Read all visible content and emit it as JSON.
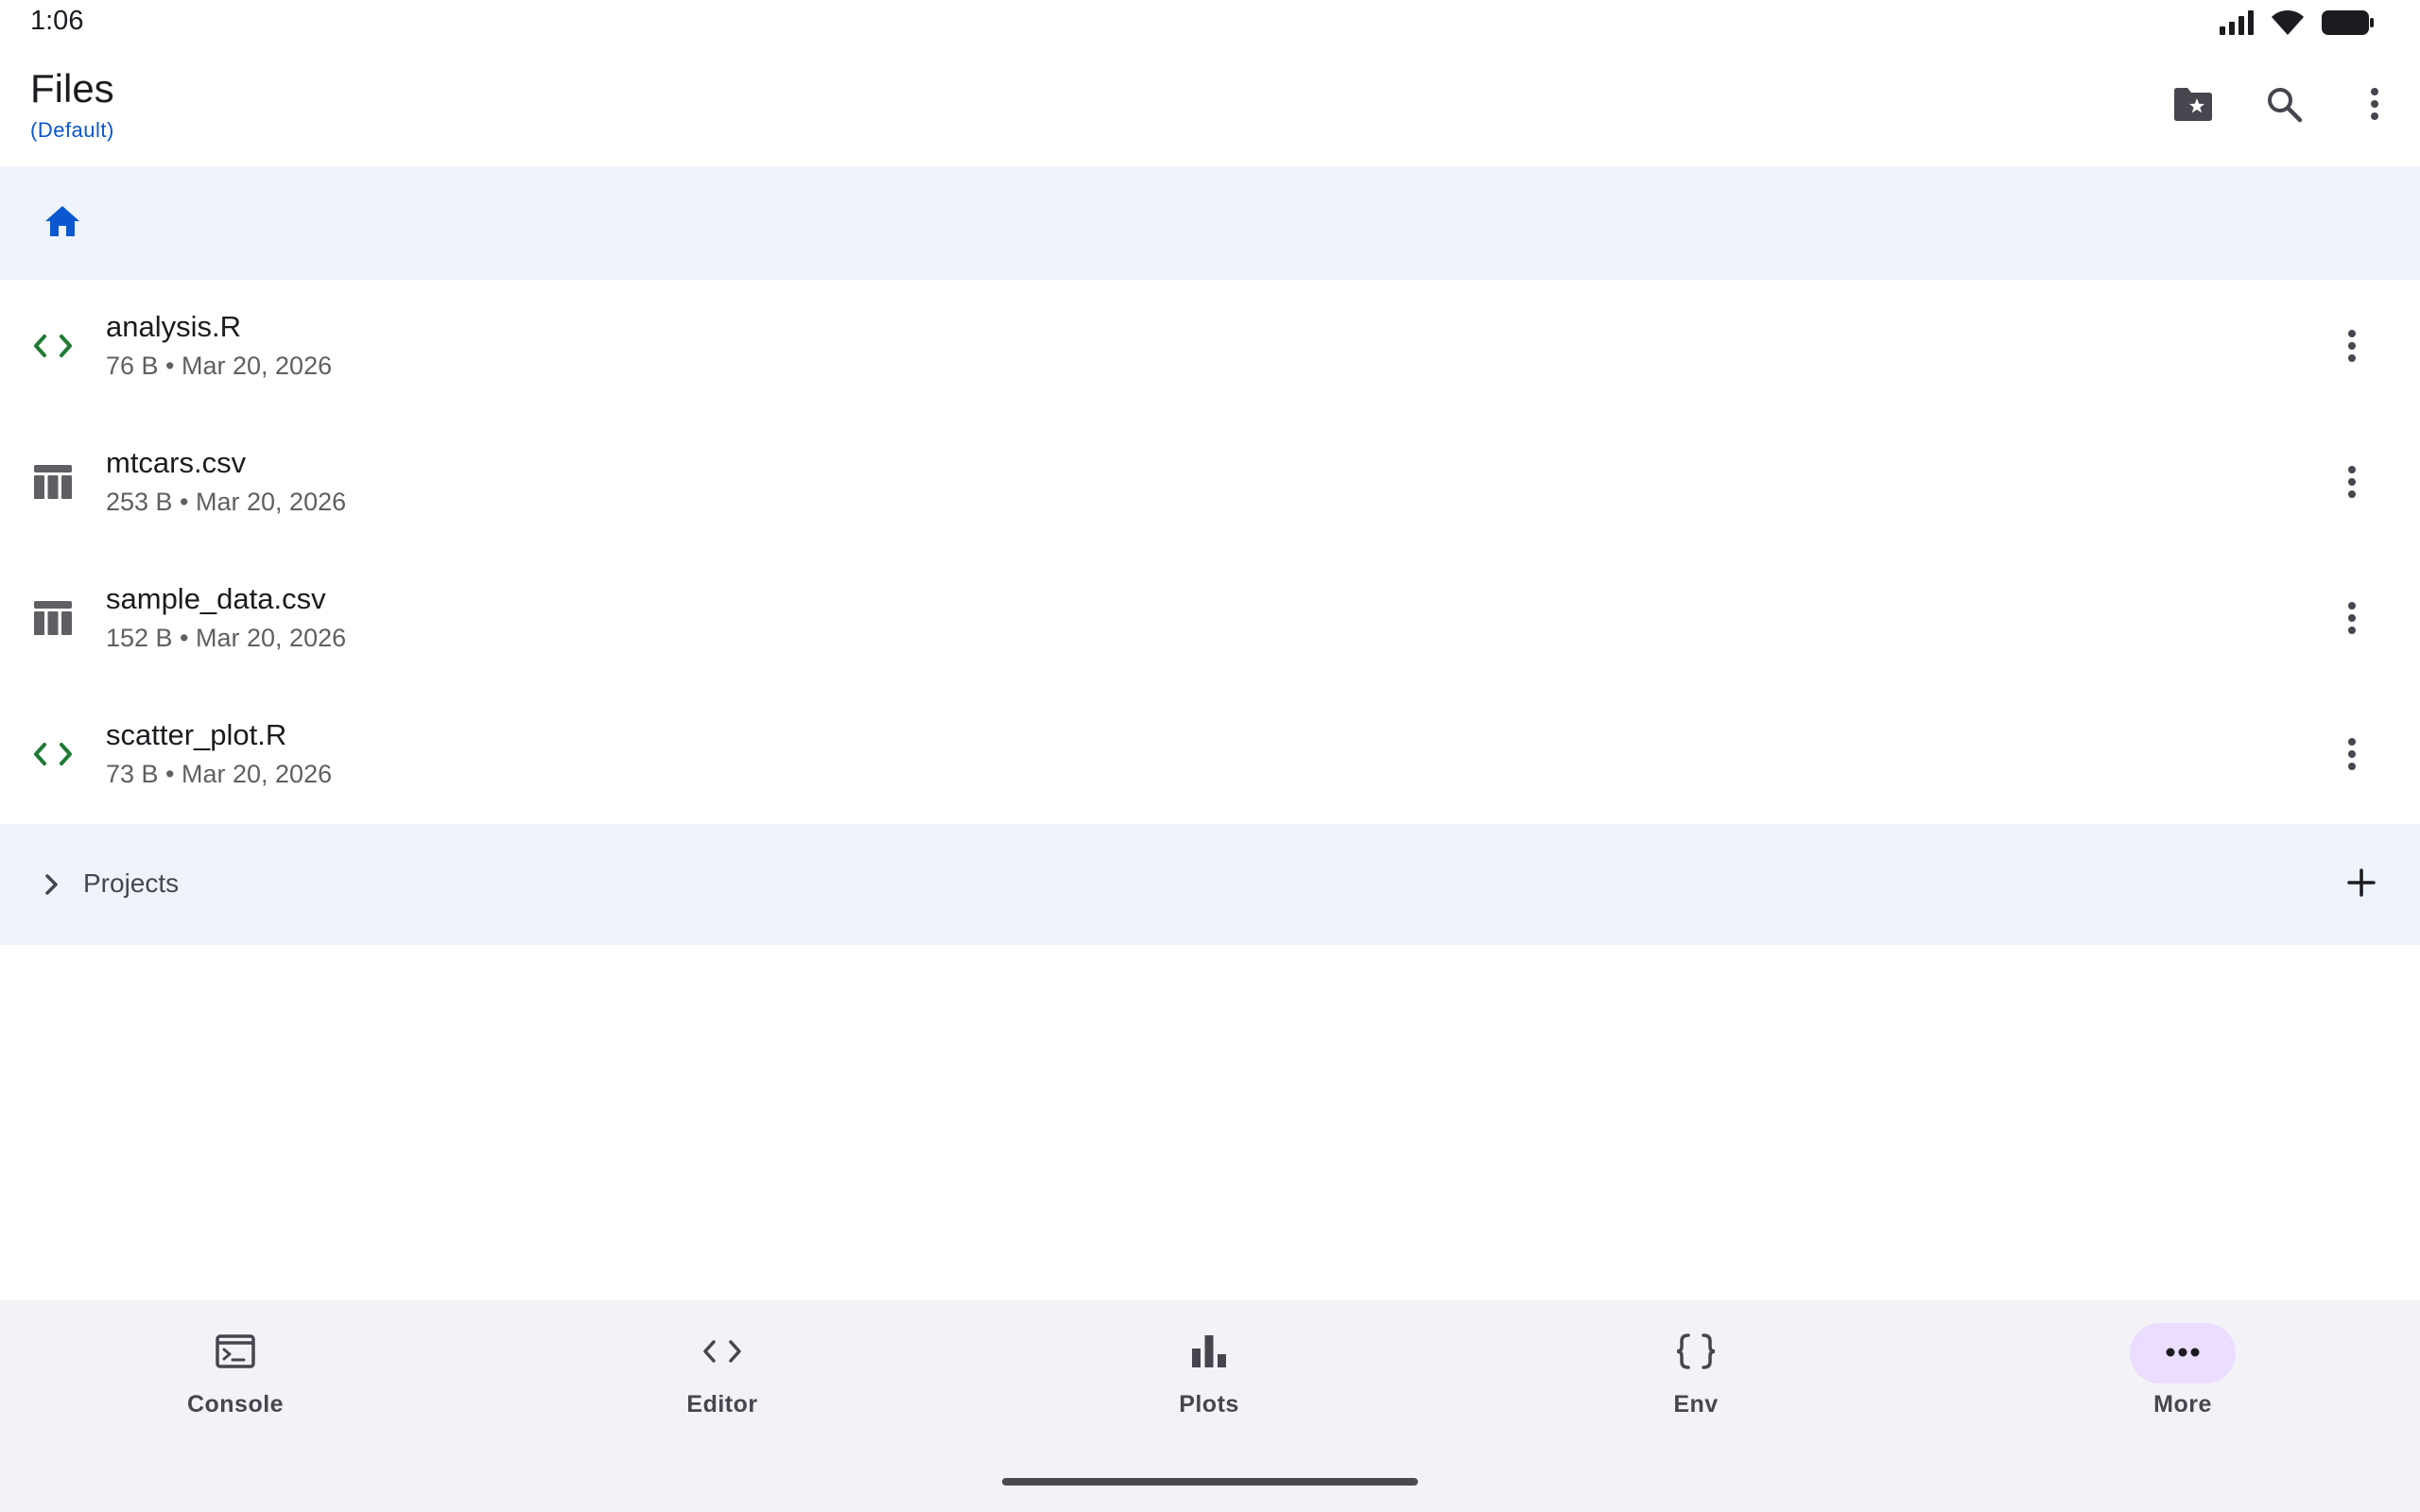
{
  "status_bar": {
    "time": "1:06"
  },
  "header": {
    "title": "Files",
    "subtitle": "(Default)"
  },
  "files": [
    {
      "name": "analysis.R",
      "meta": "76 B • Mar 20, 2026",
      "icon": "code-icon"
    },
    {
      "name": "mtcars.csv",
      "meta": "253 B • Mar 20, 2026",
      "icon": "table-icon"
    },
    {
      "name": "sample_data.csv",
      "meta": "152 B • Mar 20, 2026",
      "icon": "table-icon"
    },
    {
      "name": "scatter_plot.R",
      "meta": "73 B • Mar 20, 2026",
      "icon": "code-icon"
    }
  ],
  "projects": {
    "label": "Projects"
  },
  "bottom_nav": [
    {
      "label": "Console",
      "icon": "terminal-icon"
    },
    {
      "label": "Editor",
      "icon": "code-icon"
    },
    {
      "label": "Plots",
      "icon": "bar-chart-icon"
    },
    {
      "label": "Env",
      "icon": "braces-icon"
    },
    {
      "label": "More",
      "icon": "more-horiz-icon",
      "active": true
    }
  ],
  "colors": {
    "accent": "#0b57d0",
    "code_icon": "#1e7b34",
    "breadcrumb_bg": "#eff3fc",
    "nav_active": "#eaddff"
  }
}
